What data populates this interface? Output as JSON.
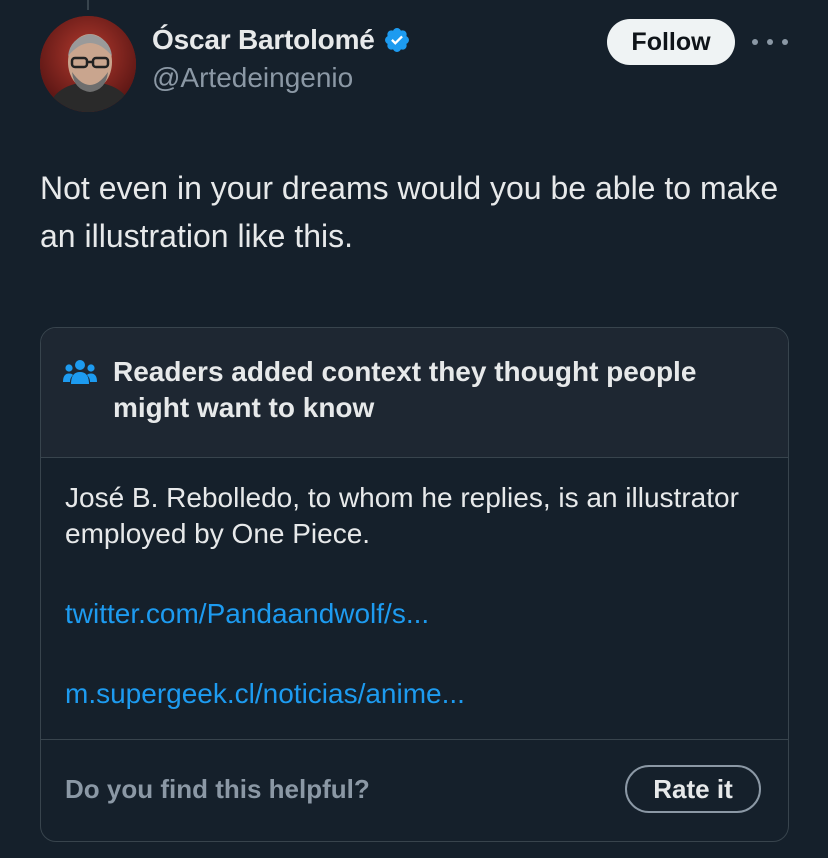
{
  "author": {
    "display_name": "Óscar Bartolomé",
    "handle": "@Artedeingenio",
    "verified": true
  },
  "follow_label": "Follow",
  "tweet_text": "Not even in your dreams would you be able to make an illustration like this.",
  "community_note": {
    "title": "Readers added context they thought people might want to know",
    "body": "José B. Rebolledo, to whom he replies, is an illustrator employed by One Piece.",
    "links": [
      "twitter.com/Pandaandwolf/s...",
      "m.supergeek.cl/noticias/anime..."
    ],
    "helpful_question": "Do you find this helpful?",
    "rate_label": "Rate it"
  },
  "colors": {
    "background": "#15202b",
    "text": "#e7e9ea",
    "muted": "#8b98a5",
    "link": "#1d9bf0",
    "verified": "#1d9bf0"
  },
  "icons": [
    "avatar-photo",
    "verified-badge-icon",
    "more-options-icon",
    "people-icon"
  ]
}
